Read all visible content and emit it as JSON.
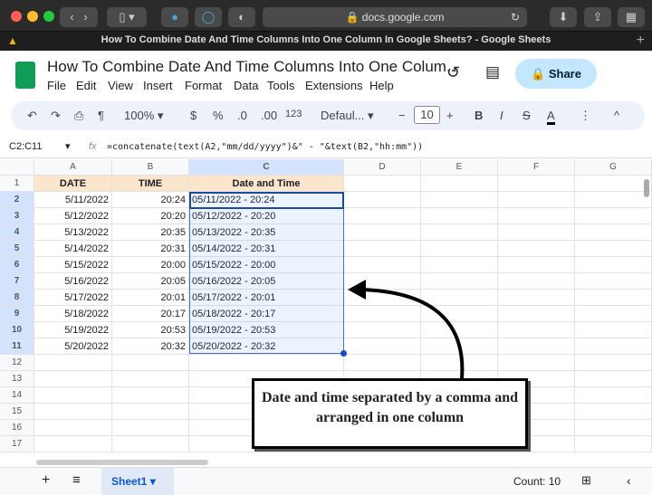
{
  "browser": {
    "url": "docs.google.com",
    "tab_title": "How To Combine Date And Time Columns Into One Column In Google Sheets? - Google Sheets"
  },
  "doc": {
    "title": "How To Combine Date And Time Columns Into One Colum...",
    "share": "Share",
    "menu": [
      "File",
      "Edit",
      "View",
      "Insert",
      "Format",
      "Data",
      "Tools",
      "Extensions",
      "Help"
    ]
  },
  "toolbar": {
    "zoom": "100%",
    "currency": "$",
    "percent": "%",
    "dec_dec": ".0",
    "dec_inc": ".00",
    "format": "123",
    "font": "Defaul...",
    "font_size": "10",
    "bold": "B",
    "italic": "I",
    "text_color": "A"
  },
  "formula_bar": {
    "range": "C2:C11",
    "fx": "fx",
    "formula": "=concatenate(text(A2,\"mm/dd/yyyy\")&\" - \"&text(B2,\"hh:mm\"))"
  },
  "sheet": {
    "columns": [
      "A",
      "B",
      "C",
      "D",
      "E",
      "F",
      "G"
    ],
    "headers": [
      "DATE",
      "TIME",
      "Date and Time"
    ],
    "rows": [
      [
        "5/11/2022",
        "20:24",
        "05/11/2022 - 20:24"
      ],
      [
        "5/12/2022",
        "20:20",
        "05/12/2022 - 20:20"
      ],
      [
        "5/13/2022",
        "20:35",
        "05/13/2022 - 20:35"
      ],
      [
        "5/14/2022",
        "20:31",
        "05/14/2022 - 20:31"
      ],
      [
        "5/15/2022",
        "20:00",
        "05/15/2022 - 20:00"
      ],
      [
        "5/16/2022",
        "20:05",
        "05/16/2022 - 20:05"
      ],
      [
        "5/17/2022",
        "20:01",
        "05/17/2022 - 20:01"
      ],
      [
        "5/18/2022",
        "20:17",
        "05/18/2022 - 20:17"
      ],
      [
        "5/19/2022",
        "20:53",
        "05/19/2022 - 20:53"
      ],
      [
        "5/20/2022",
        "20:32",
        "05/20/2022 - 20:32"
      ]
    ],
    "row_count": 17
  },
  "bottom": {
    "sheet_tab": "Sheet1",
    "count": "Count: 10"
  },
  "annotation": "Date and time separated by a comma and arranged in one column"
}
